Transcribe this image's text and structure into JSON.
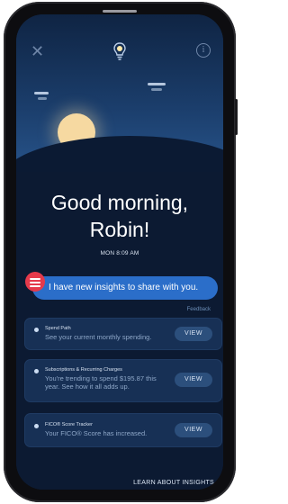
{
  "header": {
    "close_glyph": "✕",
    "center_icon": "lightbulb-icon",
    "info_glyph": "i"
  },
  "greeting": {
    "line1": "Good morning,",
    "line2": "Robin!",
    "datetime": "MON 8:09 AM"
  },
  "message": {
    "text": "I have new insights to share with you.",
    "feedback": "Feedback"
  },
  "insights": [
    {
      "title": "Spend Path",
      "body": "See your current monthly spending.",
      "action": "VIEW"
    },
    {
      "title": "Subscriptions & Recurring Charges",
      "body": "You're trending to spend $195.87 this year. See how it all adds up.",
      "action": "VIEW"
    },
    {
      "title": "FICO® Score Tracker",
      "body": "Your FICO® Score has increased.",
      "action": "VIEW"
    }
  ],
  "footer": {
    "learn_link": "LEARN ABOUT INSIGHTS"
  },
  "colors": {
    "accent": "#2b6ec9",
    "avatar": "#e53a4b",
    "background": "#0c1a32",
    "card": "#173055"
  }
}
